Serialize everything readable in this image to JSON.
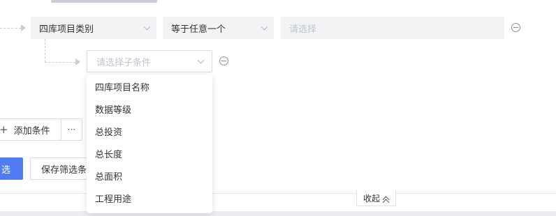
{
  "condition_row": {
    "field_value": "四库项目类别",
    "operator_value": "等于任意一个",
    "value_placeholder": "请选择"
  },
  "sub_condition": {
    "placeholder": "请选择子条件",
    "options": [
      "四库项目名称",
      "数据等级",
      "总投资",
      "总长度",
      "总面积",
      "工程用途"
    ]
  },
  "actions": {
    "add_icon": "+",
    "add_condition": "添加条件",
    "more": "···",
    "filter": "选",
    "save_filter": "保存筛选条"
  },
  "footer": {
    "collapse_label": "收起",
    "collapse_icon": "≈"
  },
  "icons": {
    "remove": "minus-circle-icon",
    "chevron": "chevron-down-icon",
    "collapse": "double-chevron-up-icon"
  },
  "colors": {
    "primary": "#4f7cf5",
    "input_bg": "#f2f3f5",
    "placeholder": "#c0c4cc",
    "connector": "#c9ccd4"
  }
}
